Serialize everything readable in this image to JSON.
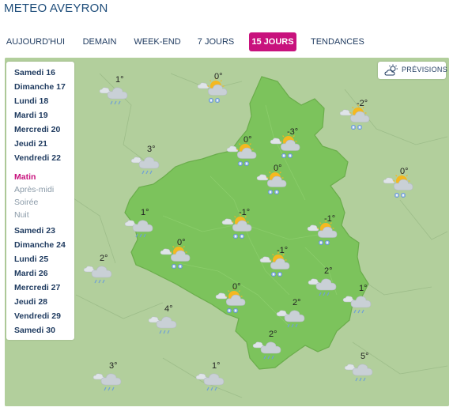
{
  "header": {
    "title": "METEO AVEYRON"
  },
  "tabs": [
    {
      "label": "AUJOURD'HUI",
      "active": false
    },
    {
      "label": "DEMAIN",
      "active": false
    },
    {
      "label": "WEEK-END",
      "active": false
    },
    {
      "label": "7 JOURS",
      "active": false
    },
    {
      "label": "15 JOURS",
      "active": true
    },
    {
      "label": "TENDANCES",
      "active": false
    }
  ],
  "days_top": [
    "Samedi 16",
    "Dimanche 17",
    "Lundi 18",
    "Mardi 19",
    "Mercredi 20",
    "Jeudi 21",
    "Vendredi 22"
  ],
  "periods": [
    {
      "label": "Matin",
      "selected": true
    },
    {
      "label": "Après-midi",
      "selected": false
    },
    {
      "label": "Soirée",
      "selected": false
    },
    {
      "label": "Nuit",
      "selected": false
    }
  ],
  "days_bottom": [
    "Samedi 23",
    "Dimanche 24",
    "Lundi 25",
    "Mardi 26",
    "Mercredi 27",
    "Jeudi 28",
    "Vendredi 29",
    "Samedi 30"
  ],
  "previsions_button": {
    "label": "PRÉVISIONS",
    "icon": "cloud-sun-icon"
  },
  "forecasts": [
    {
      "temp": "1°",
      "icon": "rain-icon"
    },
    {
      "temp": "0°",
      "icon": "sun-snow-icon"
    },
    {
      "temp": "-2°",
      "icon": "sun-snow-icon"
    },
    {
      "temp": "-3°",
      "icon": "sun-snow-icon"
    },
    {
      "temp": "0°",
      "icon": "sun-snow-icon"
    },
    {
      "temp": "3°",
      "icon": "rain-icon"
    },
    {
      "temp": "0°",
      "icon": "sun-snow-icon"
    },
    {
      "temp": "0°",
      "icon": "sun-snow-icon"
    },
    {
      "temp": "1°",
      "icon": "rain-icon"
    },
    {
      "temp": "-1°",
      "icon": "sun-snow-icon"
    },
    {
      "temp": "-1°",
      "icon": "sun-snow-icon"
    },
    {
      "temp": "0°",
      "icon": "sun-snow-icon"
    },
    {
      "temp": "-1°",
      "icon": "sun-snow-icon"
    },
    {
      "temp": "2°",
      "icon": "rain-icon"
    },
    {
      "temp": "2°",
      "icon": "rain-icon"
    },
    {
      "temp": "1°",
      "icon": "rain-icon"
    },
    {
      "temp": "0°",
      "icon": "sun-snow-icon"
    },
    {
      "temp": "2°",
      "icon": "rain-icon"
    },
    {
      "temp": "4°",
      "icon": "rain-icon"
    },
    {
      "temp": "2°",
      "icon": "rain-icon"
    },
    {
      "temp": "3°",
      "icon": "rain-icon"
    },
    {
      "temp": "1°",
      "icon": "rain-icon"
    },
    {
      "temp": "5°",
      "icon": "rain-icon"
    }
  ],
  "colors": {
    "accent": "#c8127d",
    "nav_text": "#1e3a5f",
    "map_outside": "#b2cf9c",
    "map_department": "#7cc35c",
    "sun": "#f5b820",
    "cloud": "#c9d0d6",
    "snow": "#5b8fd6",
    "rain": "#6f9fd8"
  }
}
